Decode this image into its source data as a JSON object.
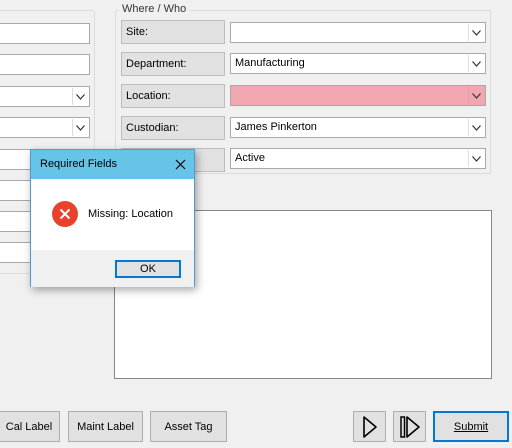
{
  "where_who": {
    "title": "Where / Who",
    "fields": [
      {
        "label": "Site:",
        "value": ""
      },
      {
        "label": "Department:",
        "value": "Manufacturing"
      },
      {
        "label": "Location:",
        "value": ""
      },
      {
        "label": "Custodian:",
        "value": "James Pinkerton"
      },
      {
        "label": "",
        "value": "Active"
      }
    ],
    "error_color": "#f2a7b0"
  },
  "toolbar": {
    "cal_label": "Cal Label",
    "maint_label": "Maint Label",
    "asset_tag": "Asset Tag",
    "submit": "Submit"
  },
  "dialog": {
    "title": "Required Fields",
    "message": "Missing: Location",
    "ok": "OK",
    "icon": "error-icon",
    "title_color": "#66c4e8",
    "icon_color": "#e8412c"
  }
}
